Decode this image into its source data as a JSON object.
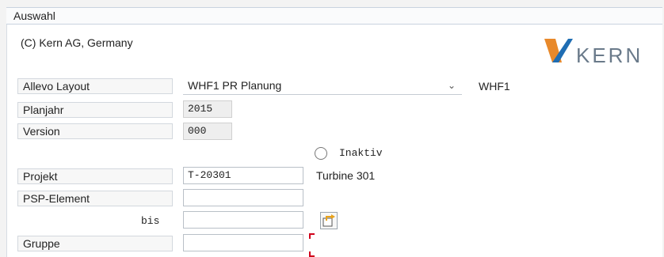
{
  "section": {
    "title": "Auswahl"
  },
  "copyright": "(C) Kern AG, Germany",
  "logo": {
    "text": "KERN",
    "colors": {
      "orange": "#e8892b",
      "blue": "#1f6db3",
      "text": "#6a7a8a"
    }
  },
  "layout_field": {
    "label": "Allevo Layout",
    "value": "WHF1 PR Planung",
    "code": "WHF1"
  },
  "planjahr": {
    "label": "Planjahr",
    "value": "2015"
  },
  "version": {
    "label": "Version",
    "value": "000"
  },
  "status_radio": {
    "label": "Inaktiv",
    "selected": false
  },
  "projekt": {
    "label": "Projekt",
    "value": "T-20301",
    "description": "Turbine 301"
  },
  "psp_element": {
    "label": "PSP-Element",
    "value": "",
    "to_label": "bis",
    "to_value": ""
  },
  "gruppe": {
    "label": "Gruppe",
    "value": ""
  },
  "colors": {
    "required_marker": "#d0021b",
    "icon_arrow": "#e8a21a"
  }
}
